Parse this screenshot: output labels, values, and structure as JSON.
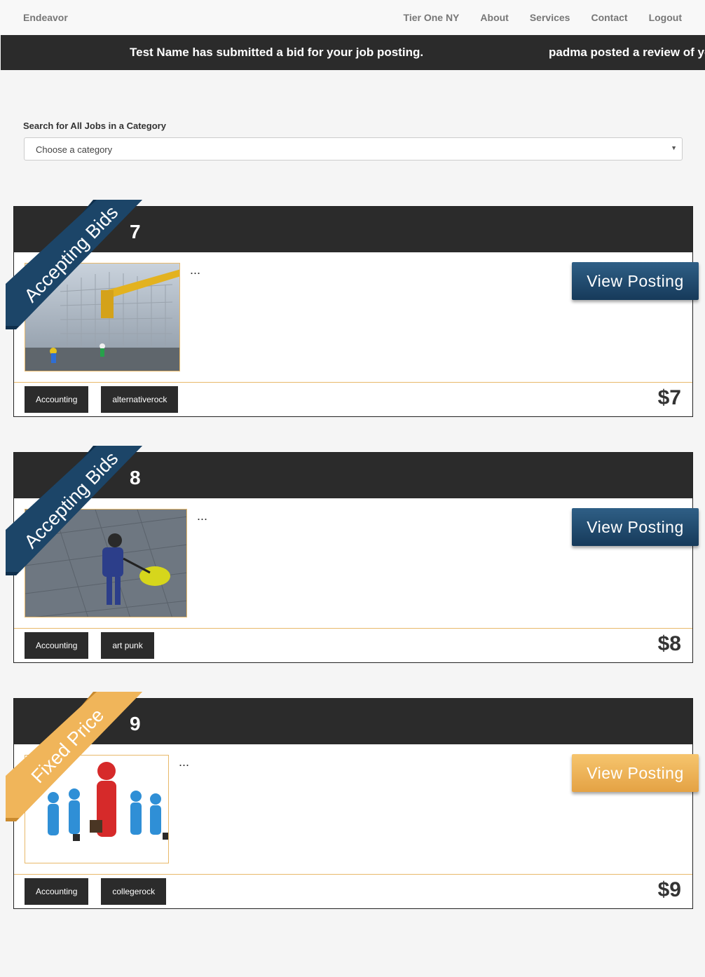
{
  "nav": {
    "brand": "Endeavor",
    "links": [
      "Tier One NY",
      "About",
      "Services",
      "Contact",
      "Logout"
    ]
  },
  "ticker": {
    "messages": [
      "Test Name has submitted a bid for your job posting.",
      "padma posted a review of yo"
    ]
  },
  "search": {
    "label": "Search for All Jobs in a Category",
    "selected": "Choose a category"
  },
  "jobs": [
    {
      "number": "7",
      "ribbon": "Accepting Bids",
      "ribbon_color": "#1c4568",
      "description": "...",
      "view_label": "View Posting",
      "tags": [
        "Accounting",
        "alternativerock"
      ],
      "price": "$7",
      "image_icon": "construction-photo"
    },
    {
      "number": "8",
      "ribbon": "Accepting Bids",
      "ribbon_color": "#1c4568",
      "description": "...",
      "view_label": "View Posting",
      "tags": [
        "Accounting",
        "art punk"
      ],
      "price": "$8",
      "image_icon": "floor-cleaning-photo"
    },
    {
      "number": "9",
      "ribbon": "Fixed Price",
      "ribbon_color": "#f0b55a",
      "description": "...",
      "view_label": "View Posting",
      "tags": [
        "Accounting",
        "collegerock"
      ],
      "price": "$9",
      "image_icon": "business-people-illustration"
    }
  ],
  "colors": {
    "dark": "#2b2b2b",
    "accent_border": "#e8b96a",
    "blue_button": "#1c4568",
    "orange_button": "#f0b55a"
  }
}
